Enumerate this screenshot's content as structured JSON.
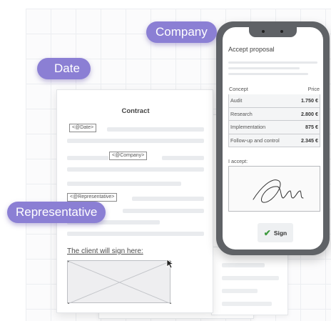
{
  "pills": {
    "date": "Date",
    "company": "Company",
    "representative": "Representative"
  },
  "contract": {
    "title": "Contract",
    "tags": {
      "date": "<@Date>",
      "company": "<@Company>",
      "representative": "<@Representative>"
    },
    "sign_label": "The client will sign here:"
  },
  "phone": {
    "title": "Accept proposal",
    "table": {
      "headers": [
        "Concept",
        "Price"
      ],
      "rows": [
        {
          "concept": "Audit",
          "price": "1.750 €"
        },
        {
          "concept": "Research",
          "price": "2.800 €"
        },
        {
          "concept": "Implementation",
          "price": "875 €"
        },
        {
          "concept": "Follow-up and control",
          "price": "2.345 €"
        }
      ]
    },
    "accept_label": "I accept:",
    "sign_button": "Sign"
  },
  "colors": {
    "pill": "#8b7fd4",
    "phone_frame": "#5f6266",
    "check": "#3e9a3e"
  },
  "icons": [
    "checkmark-icon",
    "cursor-icon",
    "signature-image"
  ]
}
